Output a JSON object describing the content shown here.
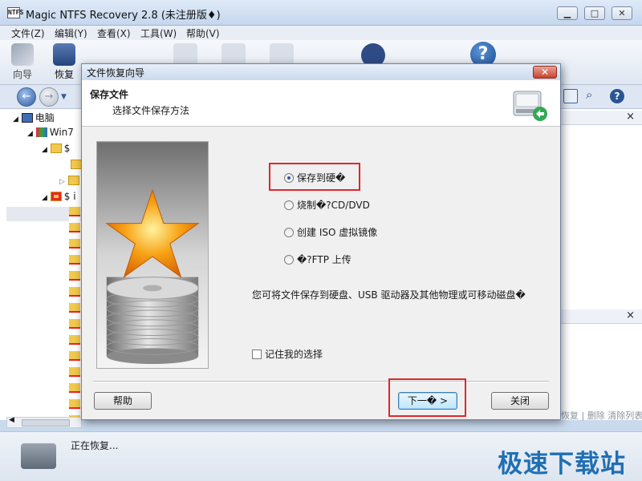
{
  "app": {
    "title": "Magic NTFS Recovery 2.8 (未注册版♦)",
    "icon_text": "NTFS",
    "window_buttons": {
      "minimize": "▁",
      "maximize": "□",
      "close": "✕"
    }
  },
  "menu": {
    "items": [
      "文件(Z)",
      "编辑(Y)",
      "查看(X)",
      "工具(W)",
      "帮助(V)"
    ]
  },
  "toolbar": {
    "wizard_label": "向导",
    "recover_label": "恢复"
  },
  "tree": {
    "items": [
      {
        "label": "电脑",
        "icon": "computer-icon"
      },
      {
        "label": "Win7",
        "icon": "network-drive-icon"
      },
      {
        "label": "$ ",
        "icon": "folder-icon"
      },
      {
        "label": "$ i",
        "icon": "deleted-folder-icon"
      }
    ]
  },
  "right_panel": {
    "close_label": "×",
    "actions": [
      "恢复",
      "删除",
      "清除列表"
    ]
  },
  "status": {
    "text": "正在恢复..."
  },
  "watermark": "极速下载站",
  "dialog": {
    "title": "文件恢复向导",
    "close_label": "✕",
    "header_title": "保存文件",
    "header_subtitle": "选择文件保存方法",
    "options": [
      {
        "label": "保存到硬�",
        "selected": true
      },
      {
        "label": "烧制�?CD/DVD",
        "selected": false
      },
      {
        "label": "创建 ISO 虚拟镜像",
        "selected": false
      },
      {
        "label": "�?FTP 上传",
        "selected": false
      }
    ],
    "description": "您可将文件保存到硬盘、USB 驱动器及其他物理或可移动磁盘�",
    "remember_label": "记住我的选择",
    "help_button": "帮助",
    "next_button": "下一� >",
    "close_button": "关闭"
  },
  "colors": {
    "highlight_box": "#e0262c",
    "watermark": "#1f6fb3",
    "star": "#f7a215"
  }
}
